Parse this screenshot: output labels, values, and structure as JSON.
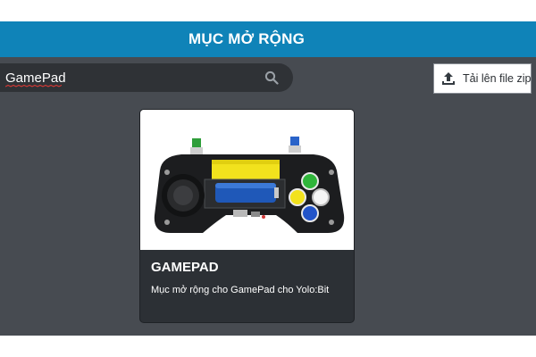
{
  "header": {
    "title": "MỤC MỞ RỘNG"
  },
  "search": {
    "value": "GamePad"
  },
  "toolbar": {
    "upload_label": "Tải lên file zip"
  },
  "extensions": [
    {
      "title": "GAMEPAD",
      "description": "Mục mở rộng cho GamePad cho Yolo:Bit"
    }
  ],
  "colors": {
    "header_bg": "#0f83b8",
    "page_bg": "#474b51",
    "card_bg": "#2c3035"
  }
}
